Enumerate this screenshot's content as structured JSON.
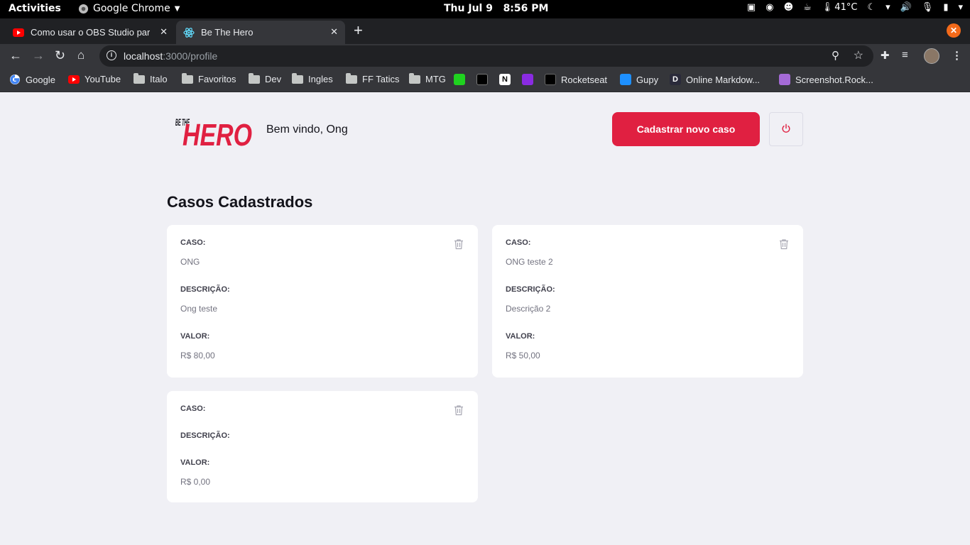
{
  "system_bar": {
    "activities": "Activities",
    "app_name": "Google Chrome",
    "clock": "Thu Jul 9   8:56 PM",
    "temperature": "41°C"
  },
  "browser": {
    "tabs": [
      {
        "title": "Como usar o OBS Studio para",
        "icon": "youtube-icon",
        "active": false
      },
      {
        "title": "Be The Hero",
        "icon": "react-icon",
        "active": true
      }
    ],
    "url_host": "localhost",
    "url_path": ":3000/profile",
    "bookmarks": [
      {
        "label": "Google",
        "icon": "google-icon"
      },
      {
        "label": "YouTube",
        "icon": "youtube-icon"
      },
      {
        "label": "Italo",
        "icon": "folder-icon"
      },
      {
        "label": "Favoritos",
        "icon": "folder-icon"
      },
      {
        "label": "Dev",
        "icon": "folder-icon"
      },
      {
        "label": "Ingles",
        "icon": "folder-icon"
      },
      {
        "label": "FF Tatics",
        "icon": "folder-icon"
      },
      {
        "label": "MTG",
        "icon": "folder-icon"
      },
      {
        "label": "",
        "icon": "green-app-icon"
      },
      {
        "label": "",
        "icon": "terminal-icon"
      },
      {
        "label": "",
        "icon": "notion-icon"
      },
      {
        "label": "",
        "icon": "purple-app-icon"
      },
      {
        "label": "Rocketseat",
        "icon": "rocketseat-icon"
      },
      {
        "label": "Gupy",
        "icon": "gupy-icon"
      },
      {
        "label": "Online Markdow...",
        "icon": "markdown-icon"
      },
      {
        "label": "Screenshot.Rock...",
        "icon": "screenshot-icon"
      }
    ]
  },
  "header": {
    "logo_top": "BE THE",
    "logo_main": "HERO",
    "welcome": "Bem vindo, Ong",
    "new_case_button": "Cadastrar novo caso"
  },
  "page_title": "Casos Cadastrados",
  "labels": {
    "case": "CASO:",
    "description": "DESCRIÇÃO:",
    "value": "VALOR:"
  },
  "cases": [
    {
      "title": "ONG",
      "description": "Ong teste",
      "value": "R$ 80,00"
    },
    {
      "title": "ONG teste 2",
      "description": "Descrição 2",
      "value": "R$ 50,00"
    },
    {
      "title": "",
      "description": "",
      "value": "R$ 0,00"
    }
  ],
  "colors": {
    "brand": "#e02041",
    "background": "#f0f0f5"
  }
}
